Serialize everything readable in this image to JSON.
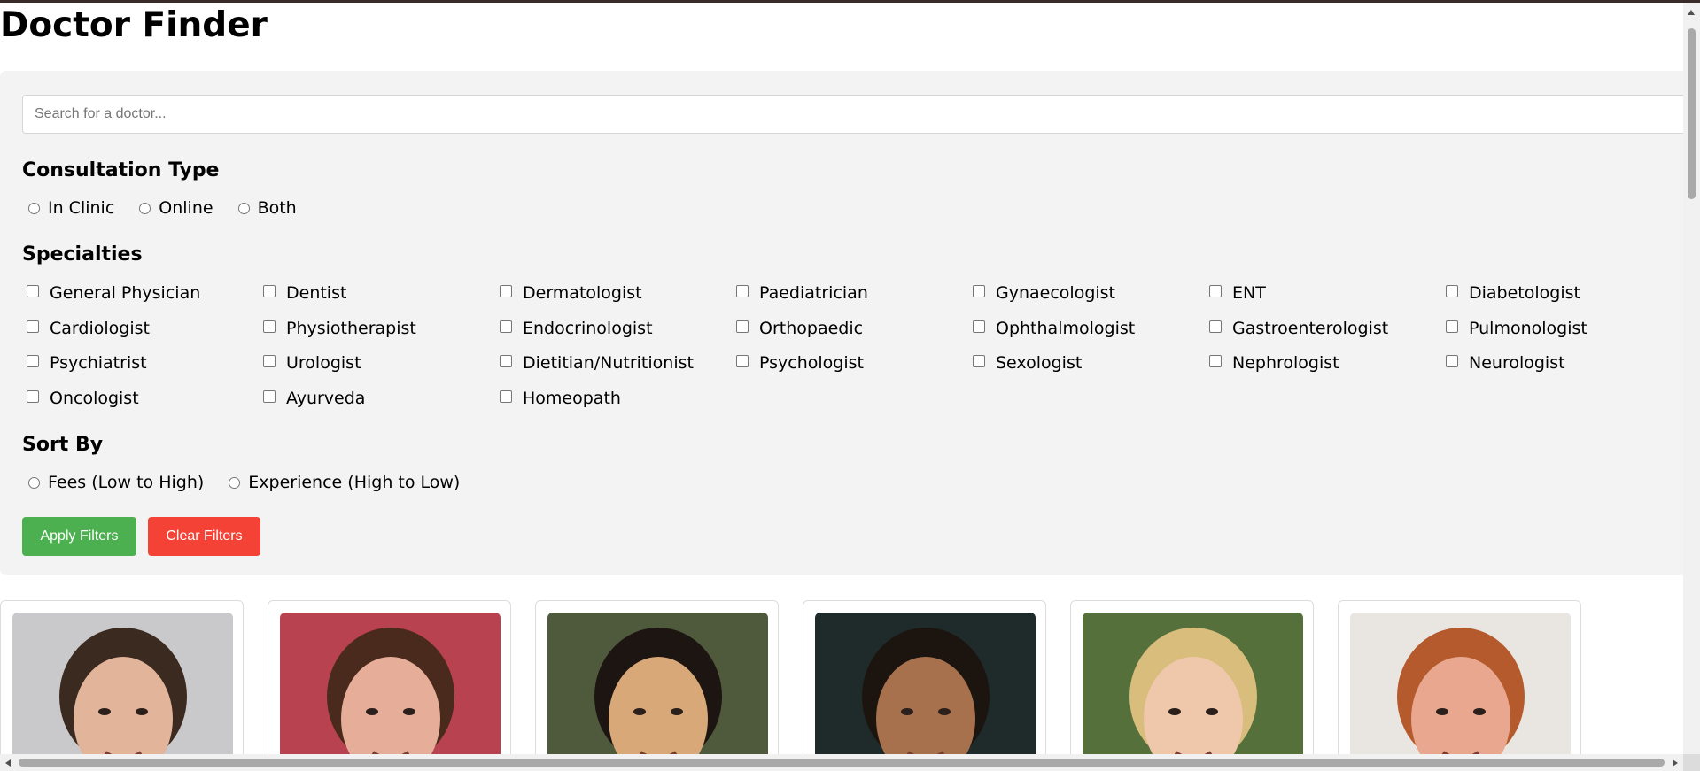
{
  "page": {
    "title": "Doctor Finder"
  },
  "search": {
    "placeholder": "Search for a doctor...",
    "value": ""
  },
  "consultation": {
    "heading": "Consultation Type",
    "options": [
      {
        "label": "In Clinic",
        "selected": false
      },
      {
        "label": "Online",
        "selected": false
      },
      {
        "label": "Both",
        "selected": false
      }
    ]
  },
  "specialties": {
    "heading": "Specialties",
    "items": [
      {
        "label": "General Physician",
        "checked": false
      },
      {
        "label": "Dentist",
        "checked": false
      },
      {
        "label": "Dermatologist",
        "checked": false
      },
      {
        "label": "Paediatrician",
        "checked": false
      },
      {
        "label": "Gynaecologist",
        "checked": false
      },
      {
        "label": "ENT",
        "checked": false
      },
      {
        "label": "Diabetologist",
        "checked": false
      },
      {
        "label": "Cardiologist",
        "checked": false
      },
      {
        "label": "Physiotherapist",
        "checked": false
      },
      {
        "label": "Endocrinologist",
        "checked": false
      },
      {
        "label": "Orthopaedic",
        "checked": false
      },
      {
        "label": "Ophthalmologist",
        "checked": false
      },
      {
        "label": "Gastroenterologist",
        "checked": false
      },
      {
        "label": "Pulmonologist",
        "checked": false
      },
      {
        "label": "Psychiatrist",
        "checked": false
      },
      {
        "label": "Urologist",
        "checked": false
      },
      {
        "label": "Dietitian/Nutritionist",
        "checked": false
      },
      {
        "label": "Psychologist",
        "checked": false
      },
      {
        "label": "Sexologist",
        "checked": false
      },
      {
        "label": "Nephrologist",
        "checked": false
      },
      {
        "label": "Neurologist",
        "checked": false
      },
      {
        "label": "Oncologist",
        "checked": false
      },
      {
        "label": "Ayurveda",
        "checked": false
      },
      {
        "label": "Homeopath",
        "checked": false
      }
    ]
  },
  "sort": {
    "heading": "Sort By",
    "options": [
      {
        "label": "Fees (Low to High)",
        "selected": false
      },
      {
        "label": "Experience (High to Low)",
        "selected": false
      }
    ]
  },
  "buttons": {
    "apply_label": "Apply Filters",
    "clear_label": "Clear Filters"
  },
  "colors": {
    "apply": "#4caf50",
    "clear": "#f44336",
    "panel": "#f3f3f3"
  },
  "doctor_cards": [
    {
      "photo": "doctor-photo-1",
      "bg": "#c9c9cc",
      "skin": "#e2b49a",
      "hair": "#3b2a20"
    },
    {
      "photo": "doctor-photo-2",
      "bg": "#b8424f",
      "skin": "#e6ad98",
      "hair": "#4a2a1c"
    },
    {
      "photo": "doctor-photo-3",
      "bg": "#4f5a3c",
      "skin": "#d9a878",
      "hair": "#1d1512"
    },
    {
      "photo": "doctor-photo-4",
      "bg": "#1f2a2a",
      "skin": "#a8714e",
      "hair": "#1c140f"
    },
    {
      "photo": "doctor-photo-5",
      "bg": "#55703a",
      "skin": "#efc8ab",
      "hair": "#d9bd7c"
    },
    {
      "photo": "doctor-photo-6",
      "bg": "#e9e6e2",
      "skin": "#e8a78e",
      "hair": "#b45a2c"
    }
  ]
}
